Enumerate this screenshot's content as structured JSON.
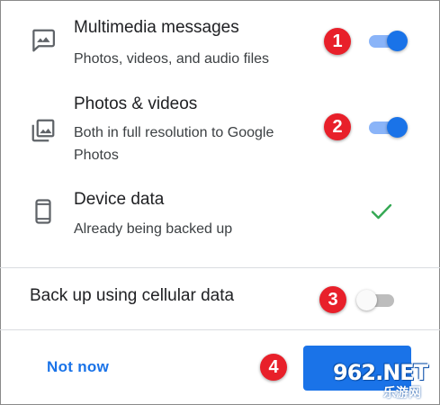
{
  "rows": [
    {
      "icon": "mms-image-icon",
      "title": "Multimedia messages",
      "subtitle": "Photos, videos, and audio files",
      "toggle_on": true,
      "badge": "1"
    },
    {
      "icon": "photo-library-icon",
      "title": "Photos & videos",
      "subtitle": "Both in full resolution to Google Photos",
      "toggle_on": true,
      "badge": "2"
    },
    {
      "icon": "phone-device-icon",
      "title": "Device data",
      "subtitle": "Already being backed up",
      "status_icon": "check-icon"
    }
  ],
  "cellular": {
    "label": "Back up using cellular data",
    "toggle_on": false,
    "badge": "3"
  },
  "footer": {
    "secondary_label": "Not now",
    "primary_label": "",
    "badge": "4"
  },
  "watermark": {
    "main": "962.NET",
    "sub": "乐游网"
  },
  "colors": {
    "accent": "#1a73e8",
    "badge": "#e8202a",
    "check": "#34a853"
  }
}
